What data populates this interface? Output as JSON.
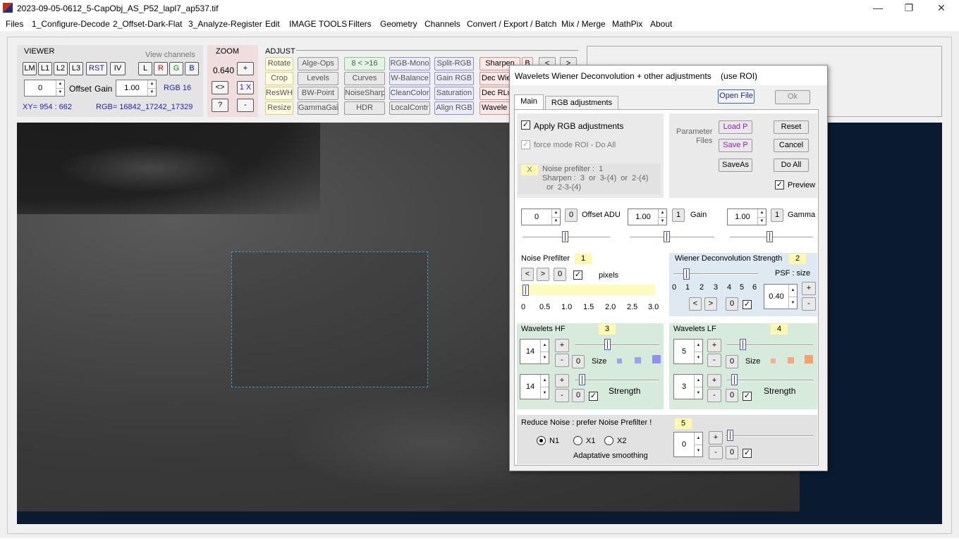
{
  "window": {
    "title": "2023-09-05-0612_5-CapObj_AS_P52_lapl7_ap537.tif",
    "minimize": "—",
    "maximize": "❐",
    "close": "✕"
  },
  "menu": [
    "Files",
    "1_Configure-Decode",
    "2_Offset-Dark-Flat",
    "3_Analyze-Register",
    "Edit",
    "IMAGE TOOLS",
    "Filters",
    "Geometry",
    "Channels",
    "Convert / Export / Batch",
    "Mix / Merge",
    "MathPix",
    "About"
  ],
  "viewer": {
    "title": "VIEWER",
    "view_channels": "View channels",
    "buttons": [
      "LM",
      "L1",
      "L2",
      "L3",
      "RST",
      "IV"
    ],
    "channels": [
      "L",
      "R",
      "G",
      "B"
    ],
    "offset_value": "0",
    "offset_label": "Offset",
    "gain_label": "Gain",
    "gain_value": "1.00",
    "rgb_mode": "RGB 16",
    "xy": "XY=  954 : 662",
    "rgb": "RGB=  16842_17242_17329"
  },
  "zoom": {
    "title": "ZOOM",
    "value": "0.640",
    "plus": "+",
    "swap": "<>",
    "onex": "1 X",
    "help": "?",
    "minus": "-"
  },
  "adjust": {
    "title": "ADJUST",
    "buttons": [
      "Rotate",
      "Alge-Ops",
      "8 < >16",
      "RGB-Mono",
      "Split-RGB",
      "Sharpen",
      "B",
      "Crop",
      "Levels",
      "Curves",
      "W-Balance",
      "Gain RGB",
      "Dec Wie",
      "ResWH",
      "BW-Point",
      "NoiseSharp",
      "CleanColor",
      "Saturation",
      "Dec RLu",
      "Resize",
      "GammaGain",
      "HDR",
      "LocalContr",
      "Align RGB",
      "Wavele"
    ],
    "nav_left": "<",
    "nav_right": ">"
  },
  "dialog": {
    "title": "Wavelets Wiener Deconvolution + other adjustments    (use ROI)",
    "tabs": [
      "Main",
      "RGB adjustments"
    ],
    "open_file": "Open File",
    "ok": "Ok",
    "apply_rgb": "Apply RGB adjustments",
    "force_mode": "force mode  ROI - Do All",
    "x_label": "X",
    "hint": "Noise prefilter :  1\nSharpen :  3  or  3-(4)  or  2-(4)\n  or  2-3-(4)",
    "param_files": "Parameter\nFiles",
    "load_p": "Load P",
    "save_p": "Save P",
    "save_as": "SaveAs",
    "reset": "Reset",
    "cancel": "Cancel",
    "do_all": "Do All",
    "preview": "Preview",
    "offset": {
      "value": "0",
      "reset": "0",
      "label": "Offset ADU"
    },
    "gain": {
      "value": "1.00",
      "reset": "1",
      "label": "Gain"
    },
    "gamma": {
      "value": "1.00",
      "reset": "1",
      "label": "Gamma"
    },
    "noise": {
      "title": "Noise Prefilter",
      "num": "1",
      "lt": "<",
      "gt": ">",
      "zero": "0",
      "pixels": "pixels",
      "ticks": [
        "0",
        "0.5",
        "1.0",
        "1.5",
        "2.0",
        "2.5",
        "3.0"
      ]
    },
    "wiener": {
      "title": "Wiener Deconvolution Strength",
      "num": "2",
      "psf": "PSF : size",
      "ticks": [
        "0",
        "1",
        "2",
        "3",
        "4",
        "5",
        "6"
      ],
      "lt": "<",
      "gt": ">",
      "zero": "0",
      "psf_value": "0.40",
      "plus": "+",
      "minus": "-"
    },
    "hf": {
      "title": "Wavelets HF",
      "num": "3",
      "size_value": "14",
      "strength_value": "14",
      "plus": "+",
      "minus": "-",
      "zero": "0",
      "size": "Size",
      "strength": "Strength"
    },
    "lf": {
      "title": "Wavelets LF",
      "num": "4",
      "size_value": "5",
      "strength_value": "3",
      "plus": "+",
      "minus": "-",
      "zero": "0",
      "size": "Size",
      "strength": "Strength"
    },
    "reduce": {
      "title": "Reduce Noise :  prefer Noise Prefilter !",
      "num": "5",
      "n1": "N1",
      "x1": "X1",
      "x2": "X2",
      "adaptive": "Adaptative smoothing",
      "value": "0",
      "plus": "+",
      "minus": "-",
      "zero": "0"
    }
  }
}
